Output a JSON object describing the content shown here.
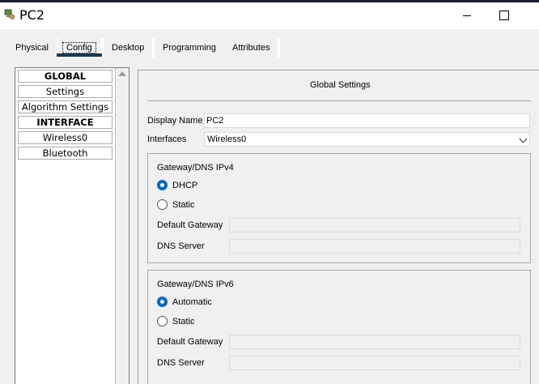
{
  "window": {
    "title": "PC2"
  },
  "tabs": [
    {
      "label": "Physical"
    },
    {
      "label": "Config"
    },
    {
      "label": "Desktop"
    },
    {
      "label": "Programming"
    },
    {
      "label": "Attributes"
    }
  ],
  "active_tab": "Config",
  "sidebar": {
    "items": [
      {
        "label": "GLOBAL",
        "header": true
      },
      {
        "label": "Settings"
      },
      {
        "label": "Algorithm Settings"
      },
      {
        "label": "INTERFACE",
        "header": true
      },
      {
        "label": "Wireless0"
      },
      {
        "label": "Bluetooth"
      }
    ]
  },
  "global_settings": {
    "title": "Global Settings",
    "display_name_label": "Display Name",
    "display_name_value": "PC2",
    "interfaces_label": "Interfaces",
    "interfaces_value": "Wireless0",
    "ipv4": {
      "title": "Gateway/DNS IPv4",
      "option_dhcp": "DHCP",
      "option_static": "Static",
      "selected": "DHCP",
      "default_gateway_label": "Default Gateway",
      "default_gateway_value": "",
      "dns_server_label": "DNS Server",
      "dns_server_value": ""
    },
    "ipv6": {
      "title": "Gateway/DNS IPv6",
      "option_automatic": "Automatic",
      "option_static": "Static",
      "selected": "Automatic",
      "default_gateway_label": "Default Gateway",
      "default_gateway_value": "",
      "dns_server_label": "DNS Server",
      "dns_server_value": ""
    }
  },
  "colors": {
    "accent": "#0067c0",
    "tab_underline": "#0c3a5c"
  }
}
